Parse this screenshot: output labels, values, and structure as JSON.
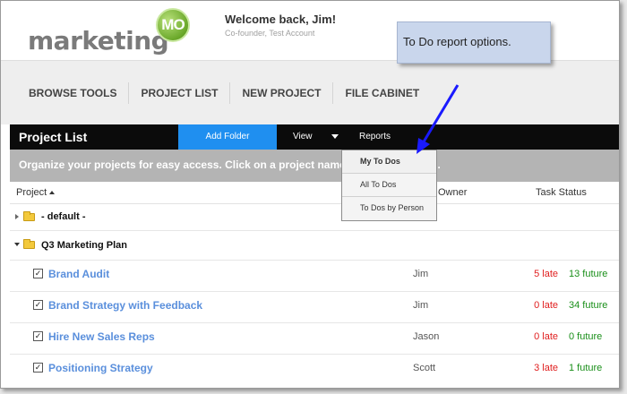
{
  "header": {
    "logo_text": "marketing",
    "logo_badge": "MO",
    "welcome": "Welcome back, Jim!",
    "subtitle": "Co-founder, Test Account"
  },
  "callout": {
    "text": "To Do report options."
  },
  "nav": {
    "items": [
      {
        "label": "BROWSE TOOLS"
      },
      {
        "label": "PROJECT LIST"
      },
      {
        "label": "NEW PROJECT"
      },
      {
        "label": "FILE CABINET"
      }
    ]
  },
  "toolbar": {
    "title": "Project List",
    "add_folder": "Add Folder",
    "view": "View",
    "reports": "Reports"
  },
  "banner": {
    "text": "Organize your projects for easy access. Click on a project name to view its details."
  },
  "dropdown": {
    "items": [
      {
        "label": "My To Dos"
      },
      {
        "label": "All To Dos"
      },
      {
        "label": "To Dos by Person"
      }
    ]
  },
  "table": {
    "col_project": "Project",
    "col_owner": "Owner",
    "col_task_status": "Task Status",
    "folders": [
      {
        "name": "- default -"
      },
      {
        "name": "Q3 Marketing Plan"
      }
    ],
    "rows": [
      {
        "name": "Brand Audit",
        "owner": "Jim",
        "late": "5 late",
        "future": "13 future"
      },
      {
        "name": "Brand Strategy with Feedback",
        "owner": "Jim",
        "late": "0 late",
        "future": "34 future"
      },
      {
        "name": "Hire New Sales Reps",
        "owner": "Jason",
        "late": "0 late",
        "future": "0 future"
      },
      {
        "name": "Positioning Strategy",
        "owner": "Scott",
        "late": "3 late",
        "future": "1 future"
      }
    ]
  },
  "colors": {
    "accent": "#1f8ff0",
    "link": "#5a8fdc",
    "late": "#e02020",
    "future": "#1a8f1a",
    "callout_bg": "#c9d6ec"
  },
  "icons": [
    "folder-icon",
    "checkbox-icon",
    "expand-triangle-icon",
    "collapse-triangle-icon",
    "sort-ascending-icon",
    "dropdown-arrow-icon"
  ]
}
